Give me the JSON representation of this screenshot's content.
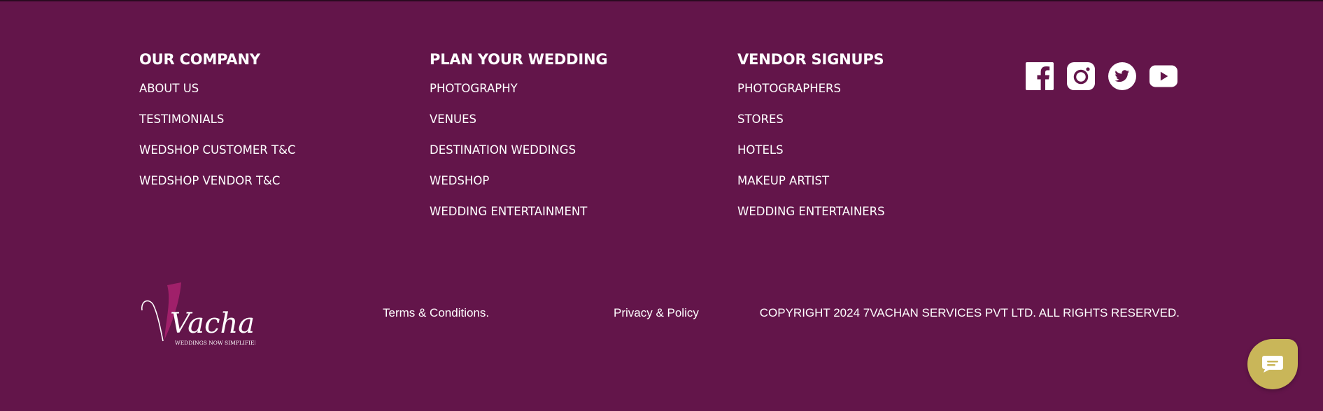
{
  "columns": [
    {
      "heading": "OUR COMPANY",
      "links": [
        "ABOUT US",
        "TESTIMONIALS",
        "WEDSHOP CUSTOMER T&C",
        "WEDSHOP VENDOR T&C"
      ]
    },
    {
      "heading": "PLAN YOUR WEDDING",
      "links": [
        "PHOTOGRAPHY",
        "VENUES",
        "DESTINATION WEDDINGS",
        "WEDSHOP",
        "WEDDING ENTERTAINMENT"
      ]
    },
    {
      "heading": "VENDOR SIGNUPS",
      "links": [
        "PHOTOGRAPHERS",
        "STORES",
        "HOTELS",
        "MAKEUP ARTIST",
        "WEDDING ENTERTAINERS"
      ]
    }
  ],
  "social": [
    "facebook-icon",
    "instagram-icon",
    "twitter-icon",
    "youtube-icon"
  ],
  "logo": {
    "numeral": "7",
    "wordmark": "Vachan",
    "tagline": "WEDDINGS NOW SIMPLIFIED"
  },
  "bottom": {
    "terms": "Terms & Conditions.",
    "privacy": "Privacy & Policy",
    "copyright": "COPYRIGHT 2024 7VACHAN SERVICES PVT LTD. ALL RIGHTS RESERVED."
  },
  "colors": {
    "background": "#63154a",
    "text": "#ffffff",
    "chat_button": "#c9b659",
    "logo_accent": "#a0206a"
  },
  "chat_icon": "chat-bubble-icon"
}
